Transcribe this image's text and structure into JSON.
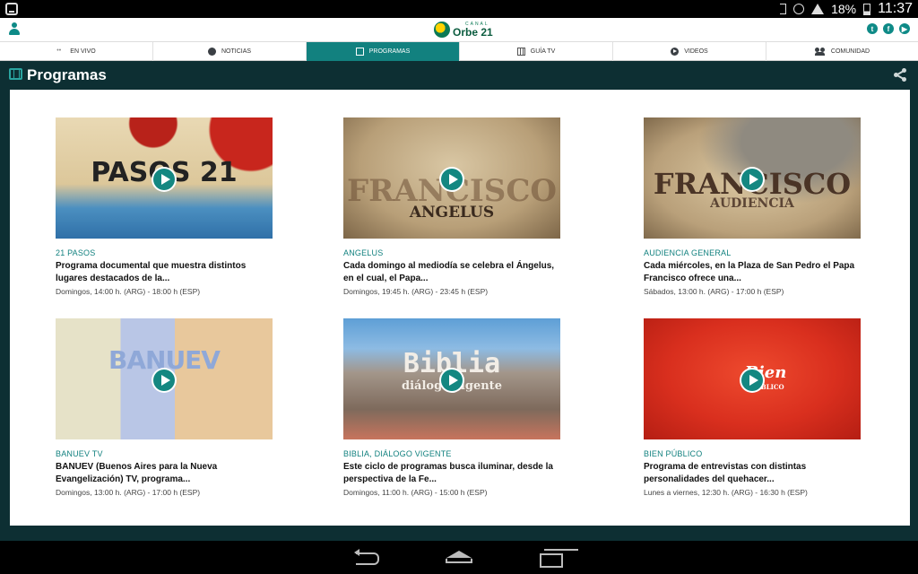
{
  "status_bar": {
    "battery": "18%",
    "time": "11:37"
  },
  "header": {
    "logo_small": "CANAL",
    "logo_name": "Orbe 21",
    "social": {
      "twitter": "t",
      "facebook": "f",
      "youtube": "▶"
    }
  },
  "nav": {
    "tabs": [
      {
        "label": "EN VIVO",
        "icon": "live-icon"
      },
      {
        "label": "NOTICIAS",
        "icon": "globe-icon"
      },
      {
        "label": "PROGRAMAS",
        "icon": "film-icon"
      },
      {
        "label": "GUÍA TV",
        "icon": "grid-icon"
      },
      {
        "label": "VIDEOS",
        "icon": "play-circle-icon"
      },
      {
        "label": "COMUNIDAD",
        "icon": "people-icon"
      }
    ],
    "active_tab": "PROGRAMAS"
  },
  "section": {
    "title": "Programas"
  },
  "programs": [
    {
      "thumb_text": "PASOS 21",
      "category": "21 PASOS",
      "description": "Programa documental que muestra distintos lugares destacados de la...",
      "schedule": "Domingos, 14:00 h. (ARG) - 18:00 h (ESP)"
    },
    {
      "thumb_text": "FRANCISCO",
      "thumb_sub": "ANGELUS",
      "category": "ANGELUS",
      "description": "Cada domingo al mediodía se celebra el Ángelus, en el cual, el Papa...",
      "schedule": "Domingos, 19:45 h. (ARG) - 23:45 h (ESP)"
    },
    {
      "thumb_text": "FRANCISCO",
      "thumb_sub": "AUDIENCIA",
      "category": "AUDIENCIA GENERAL",
      "description": "Cada miércoles, en la Plaza de San Pedro el Papa Francisco ofrece una...",
      "schedule": "Sábados, 13:00 h. (ARG) - 17:00 h (ESP)"
    },
    {
      "thumb_text": "BANUEV",
      "category": "BANUEV TV",
      "description": "BANUEV (Buenos Aires para la Nueva Evangelización) TV, programa...",
      "schedule": "Domingos, 13:00 h. (ARG) - 17:00 h (ESP)"
    },
    {
      "thumb_text": "Biblia",
      "thumb_sub": "diálogo vigente",
      "category": "BIBLIA, DIÁLOGO VIGENTE",
      "description": "Este ciclo de programas busca iluminar, desde la perspectiva de la Fe...",
      "schedule": "Domingos, 11:00 h. (ARG) - 15:00 h (ESP)"
    },
    {
      "thumb_text": "Bien",
      "thumb_sub": "PÚBLICO",
      "category": "BIEN PÚBLICO",
      "description": "Programa de entrevistas con distintas personalidades del quehacer...",
      "schedule": "Lunes a viernes, 12:30 h. (ARG) - 16:30 h (ESP)"
    }
  ],
  "colors": {
    "accent": "#12817f",
    "dark_bg": "#0d2f33",
    "play": "#148781"
  }
}
